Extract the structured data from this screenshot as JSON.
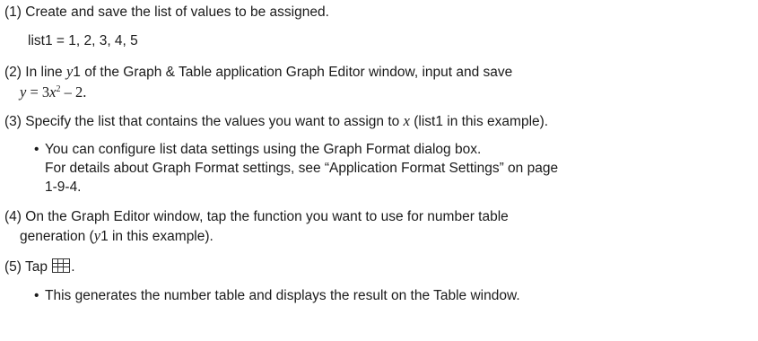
{
  "steps": [
    {
      "num": "(1)",
      "lines": [
        "Create and save the list of values to be assigned.",
        "list1 = 1, 2, 3, 4, 5"
      ]
    },
    {
      "num": "(2)",
      "line1_a": "In line ",
      "line1_var": "y",
      "line1_b": "1 of the Graph & Table application Graph Editor window, input and save",
      "line2_y": "y",
      "line2_eq": " = 3",
      "line2_x": "x",
      "line2_sup": "2",
      "line2_rest": " – 2."
    },
    {
      "num": "(3)",
      "line1_a": "Specify the list that contains the values you want to assign to ",
      "line1_var": "x",
      "line1_b": " (list1 in this example).",
      "bullet_lines": [
        "You can configure list data settings using the Graph Format dialog box.",
        "For details about Graph Format settings, see “Application Format Settings” on page",
        "1-9-4."
      ]
    },
    {
      "num": "(4)",
      "line1": "On the Graph Editor window, tap the function you want to use for number table",
      "line2_a": "generation (",
      "line2_var": "y",
      "line2_b": "1 in this example)."
    },
    {
      "num": "(5)",
      "line1_a": "Tap ",
      "line1_b": ".",
      "icon": "table-icon",
      "bullet_line": "This generates the number table and displays the result on the Table window."
    }
  ]
}
